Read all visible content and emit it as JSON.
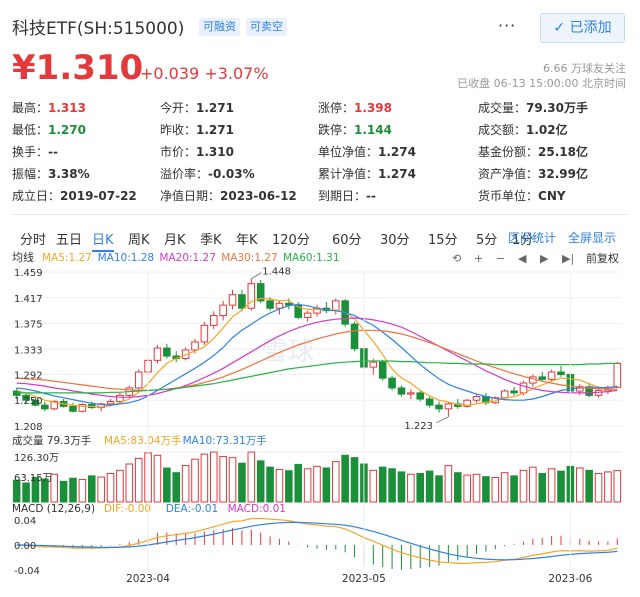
{
  "header": {
    "title": "科技ETF(SH:515000)",
    "tag_margin": "可融资",
    "tag_short": "可卖空",
    "more_label": "···",
    "added_label": "✓ 已添加"
  },
  "quote": {
    "price": "¥1.310",
    "change": "+0.039",
    "change_pct": "+3.07%",
    "followers": "6.66 万球友关注",
    "status": "已收盘 06-13 15:00:00 北京时间"
  },
  "stats": [
    [
      {
        "label": "最高：",
        "value": "1.313",
        "color": "red"
      },
      {
        "label": "今开：",
        "value": "1.271",
        "color": ""
      },
      {
        "label": "涨停：",
        "value": "1.398",
        "color": "red"
      },
      {
        "label": "成交量：",
        "value": "79.30万手",
        "color": ""
      }
    ],
    [
      {
        "label": "最低：",
        "value": "1.270",
        "color": "green"
      },
      {
        "label": "昨收：",
        "value": "1.271",
        "color": ""
      },
      {
        "label": "跌停：",
        "value": "1.144",
        "color": "green"
      },
      {
        "label": "成交额：",
        "value": "1.02亿",
        "color": ""
      }
    ],
    [
      {
        "label": "换手：",
        "value": "--",
        "color": ""
      },
      {
        "label": "市价：",
        "value": "1.310",
        "color": ""
      },
      {
        "label": "单位净值：",
        "value": "1.274",
        "color": ""
      },
      {
        "label": "基金份额：",
        "value": "25.18亿",
        "color": ""
      }
    ],
    [
      {
        "label": "振幅：",
        "value": "3.38%",
        "color": ""
      },
      {
        "label": "溢价率：",
        "value": "-0.03%",
        "color": ""
      },
      {
        "label": "累计净值：",
        "value": "1.274",
        "color": ""
      },
      {
        "label": "资产净值：",
        "value": "32.99亿",
        "color": ""
      }
    ],
    [
      {
        "label": "成立日：",
        "value": "2019-07-22",
        "color": ""
      },
      {
        "label": "净值日期：",
        "value": "2023-06-12",
        "color": ""
      },
      {
        "label": "到期日：",
        "value": "--",
        "color": ""
      },
      {
        "label": "货币单位：",
        "value": "CNY",
        "color": ""
      }
    ]
  ],
  "tabs": [
    "分时",
    "五日",
    "日K",
    "周K",
    "月K",
    "季K",
    "年K",
    "120分",
    "60分",
    "30分",
    "15分",
    "5分",
    "1分"
  ],
  "active_tab": "日K",
  "tab_right": [
    "区间统计",
    "全屏显示"
  ],
  "chart": {
    "series_label": "均线",
    "ma_legend": [
      {
        "label": "MA5:1.27",
        "color": "#f5a623"
      },
      {
        "label": "MA10:1.28",
        "color": "#2f80ed"
      },
      {
        "label": "MA20:1.27",
        "color": "#d63ac9"
      },
      {
        "label": "MA30:1.27",
        "color": "#f0733c"
      },
      {
        "label": "MA60:1.31",
        "color": "#27b24a"
      }
    ],
    "adjust_label": "前复权",
    "toolbar_icons": [
      "back-icon",
      "plus-icon",
      "minus-icon",
      "prev-icon",
      "next-icon",
      "end-icon"
    ],
    "watermark": "雪球",
    "price_ticks": [
      "1.459",
      "1.417",
      "1.375",
      "1.333",
      "1.292",
      "1.250",
      "1.208"
    ],
    "high_label": "1.448",
    "low_label": "1.223",
    "volume_label": "成交量 79.3万手",
    "volume_ma": [
      {
        "label": "MA5:83.04万手",
        "color": "#f5a623"
      },
      {
        "label": "MA10:73.31万手",
        "color": "#2f80ed"
      }
    ],
    "volume_ticks": [
      "126.30万",
      "63.15万"
    ],
    "macd_label": "MACD (12,26,9)",
    "macd_items": [
      {
        "label": "DIF:-0.00",
        "color": "#f5a623"
      },
      {
        "label": "DEA:-0.01",
        "color": "#2f80ed"
      },
      {
        "label": "MACD:0.01",
        "color": "#d63ac9"
      }
    ],
    "macd_ticks": [
      "0.04",
      "0.00",
      "-0.04"
    ],
    "dates": [
      "2023-04",
      "2023-05",
      "2023-06"
    ],
    "colors": {
      "up": "#e4393c",
      "down": "#1b8f3a"
    }
  },
  "chart_data": {
    "type": "candlestick",
    "ylim": [
      1.208,
      1.459
    ],
    "candles": [
      [
        1.265,
        1.27,
        1.252,
        1.258
      ],
      [
        1.258,
        1.262,
        1.245,
        1.25
      ],
      [
        1.25,
        1.256,
        1.24,
        1.242
      ],
      [
        1.242,
        1.248,
        1.232,
        1.236
      ],
      [
        1.236,
        1.25,
        1.234,
        1.248
      ],
      [
        1.248,
        1.252,
        1.238,
        1.24
      ],
      [
        1.24,
        1.246,
        1.23,
        1.232
      ],
      [
        1.232,
        1.245,
        1.23,
        1.243
      ],
      [
        1.243,
        1.248,
        1.236,
        1.238
      ],
      [
        1.238,
        1.246,
        1.232,
        1.244
      ],
      [
        1.244,
        1.252,
        1.24,
        1.248
      ],
      [
        1.248,
        1.262,
        1.245,
        1.258
      ],
      [
        1.258,
        1.274,
        1.254,
        1.27
      ],
      [
        1.27,
        1.3,
        1.266,
        1.296
      ],
      [
        1.296,
        1.32,
        1.29,
        1.315
      ],
      [
        1.315,
        1.34,
        1.31,
        1.335
      ],
      [
        1.335,
        1.342,
        1.318,
        1.322
      ],
      [
        1.322,
        1.33,
        1.312,
        1.318
      ],
      [
        1.318,
        1.336,
        1.315,
        1.332
      ],
      [
        1.332,
        1.35,
        1.326,
        1.345
      ],
      [
        1.345,
        1.378,
        1.34,
        1.372
      ],
      [
        1.372,
        1.395,
        1.366,
        1.388
      ],
      [
        1.388,
        1.412,
        1.38,
        1.405
      ],
      [
        1.405,
        1.43,
        1.398,
        1.422
      ],
      [
        1.422,
        1.43,
        1.395,
        1.4
      ],
      [
        1.4,
        1.448,
        1.396,
        1.44
      ],
      [
        1.44,
        1.446,
        1.408,
        1.412
      ],
      [
        1.412,
        1.418,
        1.396,
        1.4
      ],
      [
        1.4,
        1.412,
        1.39,
        1.408
      ],
      [
        1.408,
        1.416,
        1.398,
        1.405
      ],
      [
        1.405,
        1.41,
        1.382,
        1.385
      ],
      [
        1.385,
        1.396,
        1.378,
        1.392
      ],
      [
        1.392,
        1.405,
        1.386,
        1.4
      ],
      [
        1.4,
        1.41,
        1.392,
        1.396
      ],
      [
        1.396,
        1.416,
        1.39,
        1.412
      ],
      [
        1.412,
        1.415,
        1.37,
        1.374
      ],
      [
        1.374,
        1.378,
        1.33,
        1.334
      ],
      [
        1.334,
        1.338,
        1.3,
        1.304
      ],
      [
        1.304,
        1.318,
        1.292,
        1.312
      ],
      [
        1.312,
        1.316,
        1.282,
        1.286
      ],
      [
        1.286,
        1.29,
        1.266,
        1.27
      ],
      [
        1.27,
        1.274,
        1.256,
        1.26
      ],
      [
        1.26,
        1.268,
        1.252,
        1.262
      ],
      [
        1.262,
        1.266,
        1.248,
        1.252
      ],
      [
        1.252,
        1.256,
        1.238,
        1.242
      ],
      [
        1.242,
        1.248,
        1.23,
        1.236
      ],
      [
        1.236,
        1.246,
        1.223,
        1.244
      ],
      [
        1.244,
        1.252,
        1.236,
        1.24
      ],
      [
        1.24,
        1.252,
        1.238,
        1.25
      ],
      [
        1.25,
        1.26,
        1.246,
        1.256
      ],
      [
        1.256,
        1.262,
        1.242,
        1.246
      ],
      [
        1.246,
        1.256,
        1.244,
        1.254
      ],
      [
        1.254,
        1.268,
        1.25,
        1.265
      ],
      [
        1.265,
        1.272,
        1.258,
        1.262
      ],
      [
        1.262,
        1.282,
        1.258,
        1.278
      ],
      [
        1.278,
        1.292,
        1.272,
        1.288
      ],
      [
        1.288,
        1.296,
        1.28,
        1.284
      ],
      [
        1.284,
        1.3,
        1.28,
        1.296
      ],
      [
        1.296,
        1.306,
        1.288,
        1.292
      ],
      [
        1.292,
        1.296,
        1.262,
        1.265
      ],
      [
        1.265,
        1.276,
        1.258,
        1.272
      ],
      [
        1.272,
        1.278,
        1.255,
        1.258
      ],
      [
        1.258,
        1.268,
        1.254,
        1.266
      ],
      [
        1.266,
        1.274,
        1.26,
        1.271
      ],
      [
        1.271,
        1.313,
        1.27,
        1.31
      ]
    ],
    "volume": [
      55,
      48,
      62,
      58,
      70,
      52,
      60,
      57,
      66,
      63,
      72,
      80,
      96,
      110,
      124,
      118,
      86,
      74,
      92,
      108,
      121,
      126,
      115,
      112,
      98,
      126,
      104,
      88,
      82,
      79,
      95,
      84,
      90,
      86,
      102,
      118,
      112,
      96,
      80,
      88,
      84,
      76,
      70,
      72,
      78,
      66,
      92,
      74,
      68,
      70,
      64,
      62,
      74,
      66,
      80,
      88,
      72,
      84,
      78,
      90,
      86,
      80,
      72,
      76,
      79.3
    ],
    "ma5": [
      1.266,
      1.262,
      1.256,
      1.25,
      1.247,
      1.244,
      1.242,
      1.24,
      1.24,
      1.239,
      1.241,
      1.246,
      1.252,
      1.263,
      1.277,
      1.295,
      1.31,
      1.318,
      1.324,
      1.33,
      1.337,
      1.351,
      1.368,
      1.386,
      1.397,
      1.411,
      1.416,
      1.415,
      1.412,
      1.413,
      1.402,
      1.398,
      1.398,
      1.397,
      1.397,
      1.393,
      1.383,
      1.364,
      1.346,
      1.324,
      1.301,
      1.286,
      1.278,
      1.266,
      1.257,
      1.25,
      1.247,
      1.243,
      1.242,
      1.244,
      1.247,
      1.249,
      1.254,
      1.256,
      1.261,
      1.269,
      1.275,
      1.281,
      1.286,
      1.285,
      1.283,
      1.277,
      1.271,
      1.266,
      1.273
    ],
    "ma10": [
      1.27,
      1.268,
      1.265,
      1.261,
      1.257,
      1.254,
      1.251,
      1.248,
      1.245,
      1.243,
      1.242,
      1.244,
      1.246,
      1.25,
      1.257,
      1.266,
      1.275,
      1.284,
      1.293,
      1.302,
      1.312,
      1.323,
      1.336,
      1.352,
      1.364,
      1.374,
      1.384,
      1.392,
      1.399,
      1.404,
      1.406,
      1.404,
      1.4,
      1.397,
      1.396,
      1.393,
      1.388,
      1.38,
      1.372,
      1.361,
      1.349,
      1.336,
      1.322,
      1.308,
      1.296,
      1.285,
      1.276,
      1.27,
      1.265,
      1.26,
      1.256,
      1.253,
      1.251,
      1.25,
      1.25,
      1.252,
      1.256,
      1.261,
      1.266,
      1.268,
      1.27,
      1.271,
      1.271,
      1.27,
      1.273
    ],
    "ma20": [
      1.278,
      1.277,
      1.275,
      1.273,
      1.27,
      1.268,
      1.265,
      1.263,
      1.26,
      1.258,
      1.256,
      1.255,
      1.255,
      1.256,
      1.258,
      1.261,
      1.265,
      1.269,
      1.274,
      1.28,
      1.287,
      1.294,
      1.302,
      1.311,
      1.32,
      1.329,
      1.338,
      1.347,
      1.355,
      1.362,
      1.368,
      1.373,
      1.377,
      1.38,
      1.382,
      1.383,
      1.384,
      1.383,
      1.381,
      1.378,
      1.374,
      1.369,
      1.362,
      1.354,
      1.346,
      1.338,
      1.33,
      1.322,
      1.314,
      1.306,
      1.298,
      1.291,
      1.284,
      1.278,
      1.273,
      1.269,
      1.266,
      1.264,
      1.263,
      1.262,
      1.262,
      1.262,
      1.263,
      1.264,
      1.266
    ],
    "ma30": [
      1.286,
      1.285,
      1.284,
      1.283,
      1.281,
      1.279,
      1.277,
      1.275,
      1.273,
      1.271,
      1.269,
      1.268,
      1.267,
      1.266,
      1.266,
      1.267,
      1.268,
      1.27,
      1.272,
      1.275,
      1.279,
      1.283,
      1.288,
      1.294,
      1.3,
      1.307,
      1.314,
      1.321,
      1.328,
      1.334,
      1.34,
      1.345,
      1.35,
      1.354,
      1.358,
      1.361,
      1.363,
      1.364,
      1.364,
      1.363,
      1.361,
      1.358,
      1.354,
      1.349,
      1.344,
      1.338,
      1.332,
      1.326,
      1.32,
      1.314,
      1.308,
      1.303,
      1.298,
      1.293,
      1.289,
      1.285,
      1.281,
      1.278,
      1.275,
      1.273,
      1.271,
      1.27,
      1.269,
      1.268,
      1.268
    ],
    "ma60": [
      1.262,
      1.262,
      1.262,
      1.262,
      1.262,
      1.262,
      1.262,
      1.262,
      1.262,
      1.262,
      1.263,
      1.263,
      1.264,
      1.265,
      1.266,
      1.267,
      1.268,
      1.269,
      1.271,
      1.273,
      1.275,
      1.277,
      1.28,
      1.283,
      1.286,
      1.289,
      1.292,
      1.295,
      1.298,
      1.301,
      1.303,
      1.305,
      1.307,
      1.309,
      1.311,
      1.312,
      1.313,
      1.314,
      1.314,
      1.314,
      1.314,
      1.313,
      1.313,
      1.312,
      1.311,
      1.311,
      1.31,
      1.31,
      1.309,
      1.309,
      1.309,
      1.308,
      1.308,
      1.308,
      1.308,
      1.308,
      1.308,
      1.308,
      1.308,
      1.308,
      1.308,
      1.309,
      1.309,
      1.31,
      1.31
    ]
  }
}
